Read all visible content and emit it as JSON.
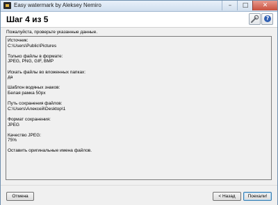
{
  "window": {
    "title": "Easy watermark by Aleksey Nemiro",
    "controls": {
      "minimize": "–",
      "maximize": "□",
      "close": "✕"
    }
  },
  "header": {
    "step_title": "Шаг 4 из 5",
    "icons": {
      "settings": "wrench-icon",
      "help": "help-icon"
    },
    "help_glyph": "?"
  },
  "main": {
    "prompt": "Пожалуйста, проверьте указанные данные.",
    "summary": [
      {
        "label": "Источник:",
        "value": "C:\\Users\\Public\\Pictures"
      },
      {
        "label": "Только файлы в формате:",
        "value": "JPEG, PNG, GIF, BMP"
      },
      {
        "label": "Искать файлы во вложенных папках:",
        "value": "да"
      },
      {
        "label": "Шаблон водяных знаков:",
        "value": "Белая рамка 50px"
      },
      {
        "label": "Путь сохранения файлов:",
        "value": "C:\\Users\\Алексей\\Desktop\\1"
      },
      {
        "label": "Формат сохранения:",
        "value": "JPEG"
      },
      {
        "label": "Качество JPEG:",
        "value": "75%"
      },
      {
        "label": "Оставить оригинальные имена файлов.",
        "value": ""
      }
    ]
  },
  "footer": {
    "cancel_label": "Отмена",
    "back_label": "< Назад",
    "finish_label": "Поехали!"
  },
  "colors": {
    "title_bar": "#cfdeee",
    "close_button": "#c9503d",
    "help_icon": "#2f5fb3",
    "panel_background": "#f0f0f0"
  }
}
